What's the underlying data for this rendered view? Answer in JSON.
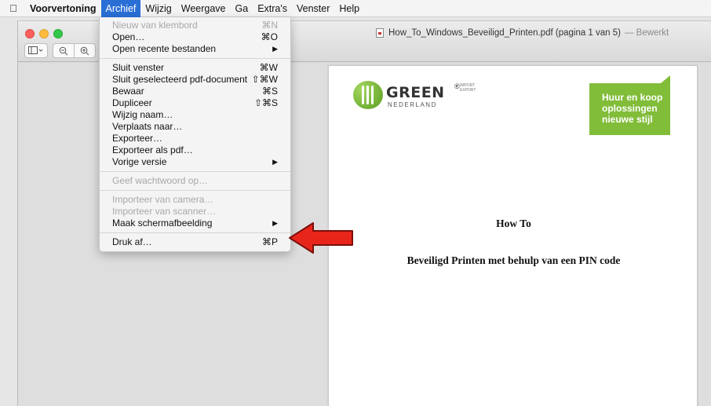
{
  "menubar": {
    "apple_icon": "apple-icon",
    "items": [
      {
        "label": "Voorvertoning"
      },
      {
        "label": "Archief"
      },
      {
        "label": "Wijzig"
      },
      {
        "label": "Weergave"
      },
      {
        "label": "Ga"
      },
      {
        "label": "Extra's"
      },
      {
        "label": "Venster"
      },
      {
        "label": "Help"
      }
    ]
  },
  "window": {
    "title": "How_To_Windows_Beveiligd_Printen.pdf (pagina 1 van 5)",
    "edited": "— Bewerkt",
    "toolbar": {
      "sidebar_icon": "sidebar-icon",
      "zoom_out_icon": "zoom-out-icon",
      "zoom_in_icon": "zoom-in-icon"
    }
  },
  "menu": {
    "groups": [
      [
        {
          "label": "Nieuw van klembord",
          "shortcut": "⌘N",
          "disabled": true
        },
        {
          "label": "Open…",
          "shortcut": "⌘O"
        },
        {
          "label": "Open recente bestanden",
          "arrow": "▶"
        }
      ],
      [
        {
          "label": "Sluit venster",
          "shortcut": "⌘W"
        },
        {
          "label": "Sluit geselecteerd pdf-document",
          "shortcut": "⇧⌘W"
        },
        {
          "label": "Bewaar",
          "shortcut": "⌘S"
        },
        {
          "label": "Dupliceer",
          "shortcut": "⇧⌘S"
        },
        {
          "label": "Wijzig naam…"
        },
        {
          "label": "Verplaats naar…"
        },
        {
          "label": "Exporteer…"
        },
        {
          "label": "Exporteer als pdf…"
        },
        {
          "label": "Vorige versie",
          "arrow": "▶"
        }
      ],
      [
        {
          "label": "Geef wachtwoord op…",
          "disabled": true
        }
      ],
      [
        {
          "label": "Importeer van camera…",
          "disabled": true
        },
        {
          "label": "Importeer van scanner…",
          "disabled": true
        },
        {
          "label": "Maak schermafbeelding",
          "arrow": "▶"
        }
      ],
      [
        {
          "label": "Druk af…",
          "shortcut": "⌘P"
        }
      ]
    ]
  },
  "document": {
    "logo": {
      "brand": "GREEN",
      "reg": "®",
      "tag1": "IMPORT",
      "tag2": "EXPORT",
      "sub": "NEDERLAND"
    },
    "badge": [
      "Huur en koop",
      "oplossingen",
      "nieuwe stijl"
    ],
    "heading": "How To",
    "subheading": "Beveiligd Printen met behulp van een PIN code"
  },
  "colors": {
    "menu_highlight": "#2a6fd6",
    "brand_green": "#82bd3a",
    "annotation_arrow": "#e8251b"
  }
}
